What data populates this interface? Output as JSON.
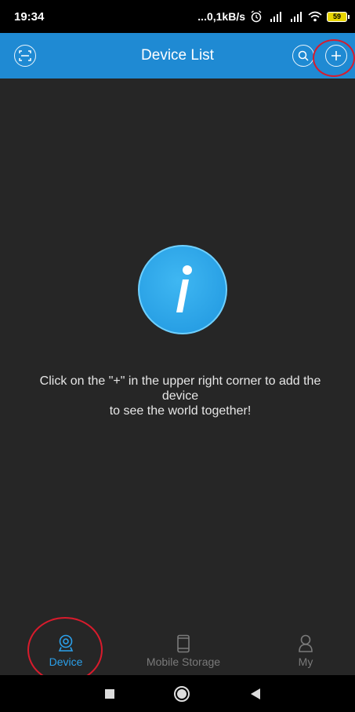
{
  "status": {
    "time": "19:34",
    "network_speed": "...0,1kB/s",
    "battery_level": "59",
    "icons": [
      "alarm-icon",
      "signal-icon",
      "signal-icon",
      "wifi-icon",
      "battery-icon"
    ]
  },
  "header": {
    "title": "Device List",
    "left_icon": "scan-icon",
    "right_icons": [
      "search-icon",
      "add-icon"
    ],
    "color": "#1f8ad3"
  },
  "main": {
    "icon": "info-icon",
    "message_line1": "Click on the \"+\" in the upper right corner to add the",
    "message_line2": "device",
    "message_line3": "to see the world together!"
  },
  "tabs": [
    {
      "label": "Device",
      "icon": "camera-icon",
      "active": true
    },
    {
      "label": "Mobile Storage",
      "icon": "phone-icon",
      "active": false
    },
    {
      "label": "My",
      "icon": "person-icon",
      "active": false
    }
  ],
  "colors": {
    "accent": "#2ba0ea",
    "background": "#262626",
    "annotation": "#d81b2c"
  }
}
